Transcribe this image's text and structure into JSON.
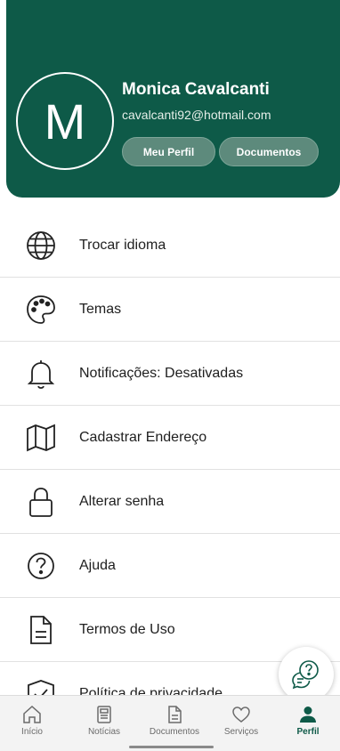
{
  "header": {
    "avatar_initial": "M",
    "name": "Monica Cavalcanti",
    "email": "cavalcanti92@hotmail.com",
    "profile_button": "Meu Perfil",
    "documents_button": "Documentos",
    "background_color": "#0e5a48"
  },
  "menu": {
    "items": [
      {
        "label": "Trocar idioma",
        "icon": "globe-icon"
      },
      {
        "label": "Temas",
        "icon": "palette-icon"
      },
      {
        "label": "Notificações: Desativadas",
        "icon": "bell-icon"
      },
      {
        "label": "Cadastrar Endereço",
        "icon": "map-icon"
      },
      {
        "label": "Alterar senha",
        "icon": "lock-icon"
      },
      {
        "label": "Ajuda",
        "icon": "help-circle-icon"
      },
      {
        "label": "Termos de Uso",
        "icon": "document-icon"
      },
      {
        "label": "Política de privacidade",
        "icon": "shield-check-icon"
      }
    ]
  },
  "help_fab": {
    "icon": "chat-help-icon"
  },
  "bottom_nav": {
    "items": [
      {
        "label": "Início",
        "icon": "home-icon"
      },
      {
        "label": "Notícias",
        "icon": "newspaper-icon"
      },
      {
        "label": "Documentos",
        "icon": "document-icon"
      },
      {
        "label": "Serviços",
        "icon": "heart-icon"
      },
      {
        "label": "Perfil",
        "icon": "user-icon",
        "active": true
      }
    ],
    "active_color": "#0e5a48"
  }
}
